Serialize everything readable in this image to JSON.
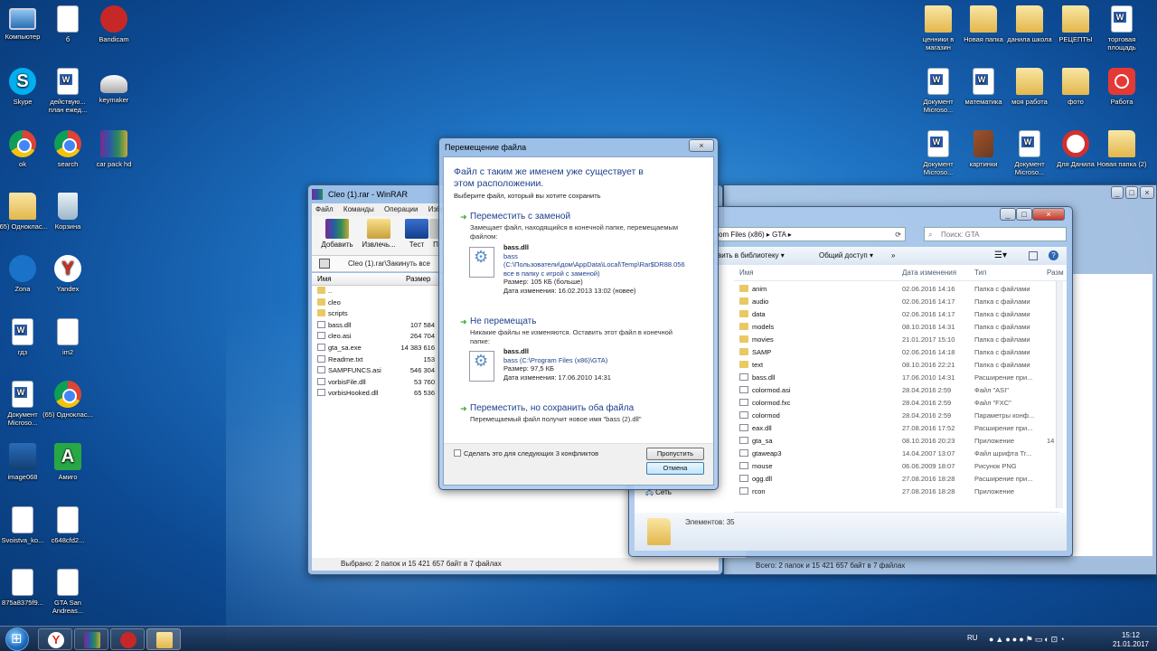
{
  "desktop_icons": [
    {
      "id": "computer",
      "label": "Компьютер",
      "x": 0
    },
    {
      "id": "b",
      "label": "б"
    },
    {
      "id": "bandicam",
      "label": "Bandicam"
    },
    {
      "id": "skype",
      "label": "Skype"
    },
    {
      "id": "plan",
      "label": "действую... план ежед..."
    },
    {
      "id": "keymaker",
      "label": "keymaker"
    },
    {
      "id": "ok",
      "label": "ok"
    },
    {
      "id": "search",
      "label": "search"
    },
    {
      "id": "carpack",
      "label": "car pack hd"
    },
    {
      "id": "odnoklas65",
      "label": "(65) Одноклас..."
    },
    {
      "id": "korzina",
      "label": "Корзина"
    },
    {
      "id": "zona",
      "label": "Zona"
    },
    {
      "id": "yandex",
      "label": "Yandex"
    },
    {
      "id": "gdz",
      "label": "гдз"
    },
    {
      "id": "im2",
      "label": "im2"
    },
    {
      "id": "docmicro",
      "label": "Документ Microso..."
    },
    {
      "id": "chrome65",
      "label": "(65) Одноклас..."
    },
    {
      "id": "image068",
      "label": "image068"
    },
    {
      "id": "amigo",
      "label": "Амиго"
    },
    {
      "id": "svoistva",
      "label": "Svoistva_ko..."
    },
    {
      "id": "c648",
      "label": "c648cfd2..."
    },
    {
      "id": "n875",
      "label": "875a8375f9..."
    },
    {
      "id": "gtasan",
      "label": "GTA San Andreas..."
    },
    {
      "id": "cenniki",
      "label": "ценники в магазин"
    },
    {
      "id": "novpap",
      "label": "Новая папка"
    },
    {
      "id": "danila",
      "label": "данила школа"
    },
    {
      "id": "recepty",
      "label": "РЕЦЕПТЫ"
    },
    {
      "id": "torg",
      "label": "торговая площадь"
    },
    {
      "id": "doc2",
      "label": "Документ Microso..."
    },
    {
      "id": "matem",
      "label": "математика"
    },
    {
      "id": "moyarab",
      "label": "моя работа"
    },
    {
      "id": "foto",
      "label": "фото"
    },
    {
      "id": "rabota",
      "label": "Работа"
    },
    {
      "id": "doc3",
      "label": "Документ Microso..."
    },
    {
      "id": "kartinki",
      "label": "картинки"
    },
    {
      "id": "doc4",
      "label": "Документ Microso..."
    },
    {
      "id": "dlyadanila",
      "label": "Для Данила"
    },
    {
      "id": "novpap2",
      "label": "Новая папка (2)"
    }
  ],
  "winrar": {
    "title": "Cleo (1).rar - WinRAR",
    "menu": [
      "Файл",
      "Команды",
      "Операции",
      "Избр"
    ],
    "toolbar": [
      "Добавить",
      "Извлечь...",
      "Тест",
      "П"
    ],
    "path": "Cleo (1).rar\\Закинуть все",
    "col_name": "Имя",
    "col_size": "Размер",
    "files": [
      {
        "name": "..",
        "size": "",
        "kind": "folder"
      },
      {
        "name": "cleo",
        "size": "",
        "kind": "folder"
      },
      {
        "name": "scripts",
        "size": "",
        "kind": "folder"
      },
      {
        "name": "bass.dll",
        "size": "107 584",
        "kind": "file"
      },
      {
        "name": "cleo.asi",
        "size": "264 704",
        "kind": "file"
      },
      {
        "name": "gta_sa.exe",
        "size": "14 383 616",
        "kind": "file"
      },
      {
        "name": "Readme.txt",
        "size": "153",
        "kind": "file"
      },
      {
        "name": "SAMPFUNCS.asi",
        "size": "546 304",
        "kind": "file"
      },
      {
        "name": "vorbisFile.dll",
        "size": "53 760",
        "kind": "file"
      },
      {
        "name": "vorbisHooked.dll",
        "size": "65 536",
        "kind": "file"
      }
    ],
    "status_left": "Выбрано: 2 папок и 15 421 657 байт в 7 файлах",
    "status_right": "Всего: 2 папок и 15 421 657 байт в 7 файлах"
  },
  "explorer": {
    "path_parts": "om Files (x86) ▸ GTA ▸",
    "search_placeholder": "Поиск: GTA",
    "cmd_library": "вить в библиотеку ▾",
    "cmd_share": "Общий доступ ▾",
    "cmd_more": "»",
    "col_name": "Имя",
    "col_date": "Дата изменения",
    "col_type": "Тип",
    "col_size": "Разм",
    "rows": [
      {
        "name": "anim",
        "date": "02.06.2016 14:16",
        "type": "Папка с файлами",
        "size": "",
        "kind": "folder"
      },
      {
        "name": "audio",
        "date": "02.06.2016 14:17",
        "type": "Папка с файлами",
        "size": "",
        "kind": "folder"
      },
      {
        "name": "data",
        "date": "02.06.2016 14:17",
        "type": "Папка с файлами",
        "size": "",
        "kind": "folder"
      },
      {
        "name": "models",
        "date": "08.10.2016 14:31",
        "type": "Папка с файлами",
        "size": "",
        "kind": "folder"
      },
      {
        "name": "movies",
        "date": "21.01.2017 15:10",
        "type": "Папка с файлами",
        "size": "",
        "kind": "folder"
      },
      {
        "name": "SAMP",
        "date": "02.06.2016 14:18",
        "type": "Папка с файлами",
        "size": "",
        "kind": "folder"
      },
      {
        "name": "text",
        "date": "08.10.2016 22:21",
        "type": "Папка с файлами",
        "size": "",
        "kind": "folder"
      },
      {
        "name": "bass.dll",
        "date": "17.06.2010 14:31",
        "type": "Расширение при...",
        "size": "",
        "kind": "file"
      },
      {
        "name": "colormod.asi",
        "date": "28.04.2016 2:59",
        "type": "Файл \"ASI\"",
        "size": "",
        "kind": "file"
      },
      {
        "name": "colormod.fxc",
        "date": "28.04.2016 2:59",
        "type": "Файл \"FXC\"",
        "size": "",
        "kind": "file"
      },
      {
        "name": "colormod",
        "date": "28.04.2016 2:59",
        "type": "Параметры конф...",
        "size": "",
        "kind": "file"
      },
      {
        "name": "eax.dll",
        "date": "27.08.2016 17:52",
        "type": "Расширение при...",
        "size": "",
        "kind": "file"
      },
      {
        "name": "gta_sa",
        "date": "08.10.2016 20:23",
        "type": "Приложение",
        "size": "14",
        "kind": "file"
      },
      {
        "name": "gtaweap3",
        "date": "14.04.2007 13:07",
        "type": "Файл шрифта Tr...",
        "size": "",
        "kind": "file"
      },
      {
        "name": "mouse",
        "date": "06.06.2009 18:07",
        "type": "Рисунок PNG",
        "size": "",
        "kind": "file"
      },
      {
        "name": "ogg.dll",
        "date": "27.08.2016 18:28",
        "type": "Расширение при...",
        "size": "",
        "kind": "file"
      },
      {
        "name": "rcon",
        "date": "27.08.2016 18:28",
        "type": "Приложение",
        "size": "",
        "kind": "file"
      }
    ],
    "nav_network": "Сеть",
    "items_count": "Элементов: 35"
  },
  "dialog": {
    "title": "Перемещение файла",
    "heading": "Файл с таким же именем уже существует в этом расположении.",
    "subheading": "Выберите файл, который вы хотите сохранить",
    "opt1_title": "Переместить с заменой",
    "opt1_desc": "Замещает файл, находящийся в конечной папке, перемещаемым файлом:",
    "file1_name": "bass.dll",
    "file1_line1": "bass",
    "file1_line2": "(C:\\Пользователи\\дом\\AppData\\Local\\Temp\\Rar$DR88.056",
    "file1_line3": "все в папку с игрой с заменой)",
    "file1_size": "Размер: 105 КБ (больше)",
    "file1_date": "Дата изменения: 16.02.2013 13:02 (новее)",
    "opt2_title": "Не перемещать",
    "opt2_desc": "Никакие файлы не изменяются. Оставить этот файл в конечной папке:",
    "file2_name": "bass.dll",
    "file2_line1": "bass (C:\\Program Files (x86)\\GTA)",
    "file2_size": "Размер: 97,5 КБ",
    "file2_date": "Дата изменения: 17.06.2010 14:31",
    "opt3_title": "Переместить, но сохранить оба файла",
    "opt3_desc": "Перемещаемый файл получит новое имя \"bass (2).dll\"",
    "checkbox_label": "Сделать это для следующих 3 конфликтов",
    "skip_label": "Пропустить",
    "cancel_label": "Отмена"
  },
  "taskbar": {
    "lang": "RU",
    "time": "15:12",
    "date": "21.01.2017"
  }
}
